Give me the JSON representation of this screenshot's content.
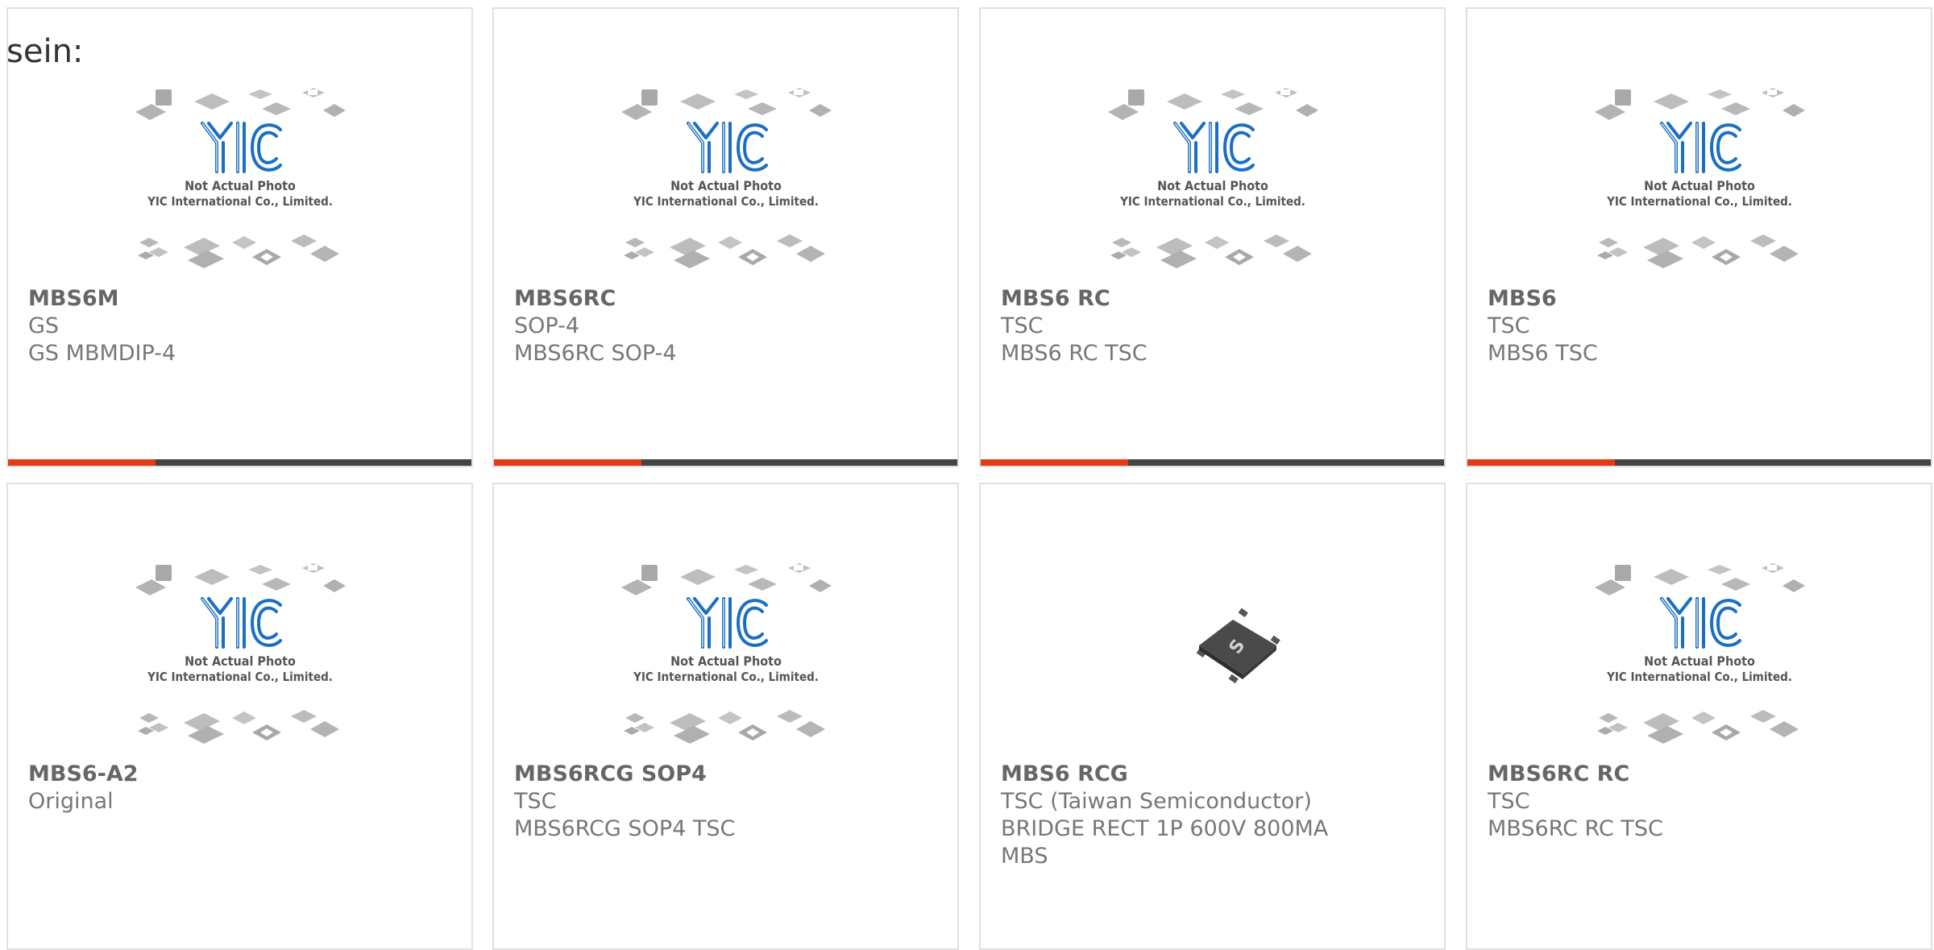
{
  "lead_text": "sein:",
  "placeholder": {
    "line1": "Not Actual Photo",
    "line2": "YIC International Co., Limited."
  },
  "colors": {
    "accent": "#e53a12",
    "bar": "#444444",
    "logo": "#1a6fc4",
    "border": "#e0e0e0"
  },
  "products": [
    {
      "name": "MBS6M",
      "lines": [
        "GS",
        "GS MBMDIP-4"
      ],
      "image": "placeholder"
    },
    {
      "name": "MBS6RC",
      "lines": [
        "SOP-4",
        "MBS6RC SOP-4"
      ],
      "image": "placeholder"
    },
    {
      "name": "MBS6 RC",
      "lines": [
        "TSC",
        "MBS6 RC TSC"
      ],
      "image": "placeholder"
    },
    {
      "name": "MBS6",
      "lines": [
        "TSC",
        "MBS6 TSC"
      ],
      "image": "placeholder"
    },
    {
      "name": "MBS6-A2",
      "lines": [
        "Original"
      ],
      "image": "placeholder"
    },
    {
      "name": "MBS6RCG SOP4",
      "lines": [
        "TSC",
        "MBS6RCG SOP4 TSC"
      ],
      "image": "placeholder"
    },
    {
      "name": "MBS6 RCG",
      "lines": [
        "TSC (Taiwan Semiconductor)",
        "BRIDGE RECT 1P 600V 800MA",
        "MBS"
      ],
      "image": "chip-photo"
    },
    {
      "name": "MBS6RC RC",
      "lines": [
        "TSC",
        "MBS6RC RC TSC"
      ],
      "image": "placeholder"
    }
  ]
}
